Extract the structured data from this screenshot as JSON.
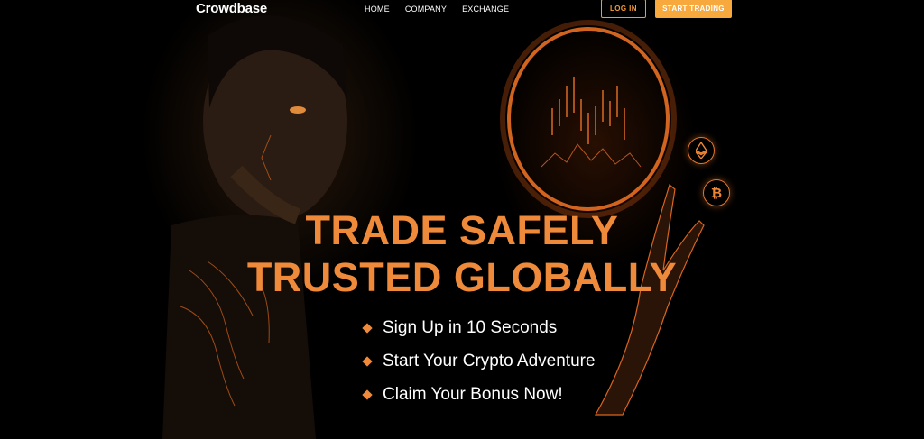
{
  "nav": {
    "brand": "Crowdbase",
    "items": [
      {
        "label": "HOME"
      },
      {
        "label": "COMPANY"
      },
      {
        "label": "EXCHANGE"
      }
    ],
    "login_label": "LOG IN",
    "start_label": "START TRADING"
  },
  "hero": {
    "headline_line1": "TRADE SAFELY",
    "headline_line2": "TRUSTED GLOBALLY",
    "bullets": [
      {
        "text": "Sign Up in 10 Seconds"
      },
      {
        "text": "Start Your Crypto Adventure"
      },
      {
        "text": "Claim Your Bonus Now!"
      }
    ],
    "coins": [
      {
        "icon": "ethereum-icon",
        "glyph": "◆"
      },
      {
        "icon": "bitcoin-icon",
        "glyph": "₿"
      }
    ]
  },
  "colors": {
    "accent": "#f08a3b",
    "button": "#f8a93d",
    "background": "#000000"
  }
}
